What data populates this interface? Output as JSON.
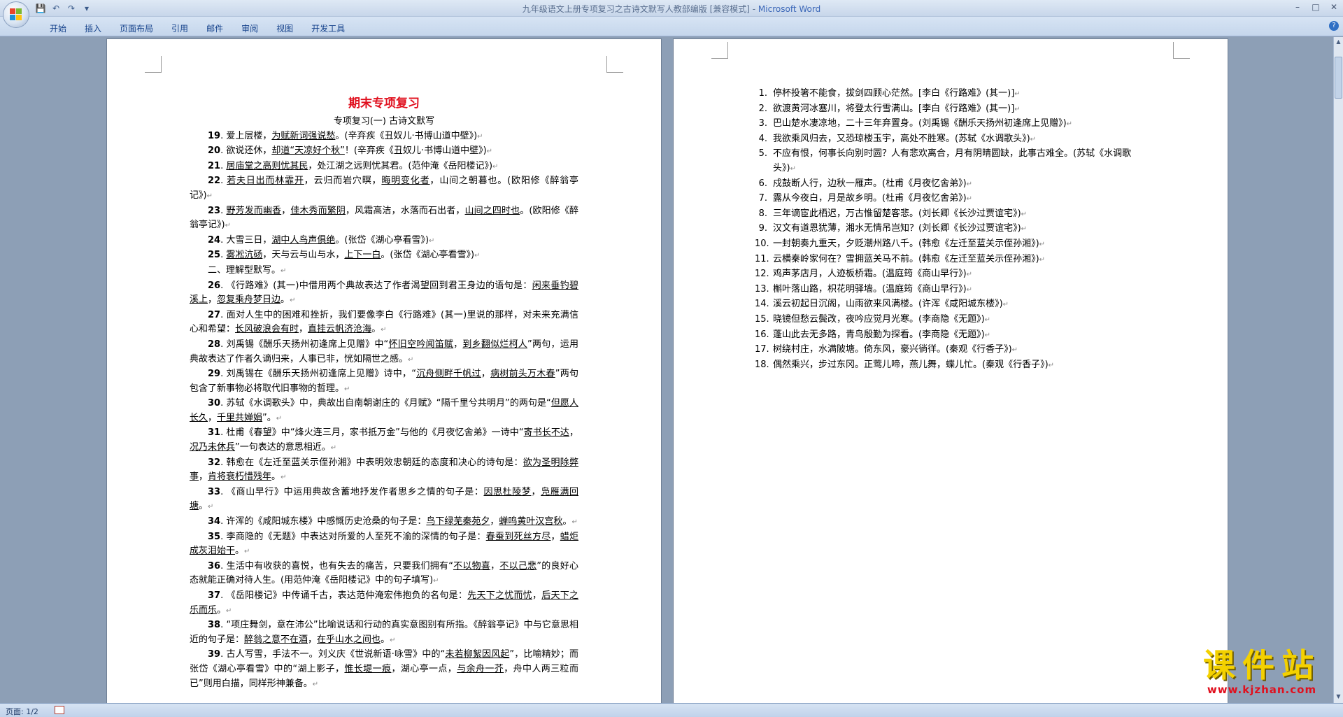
{
  "titlebar": {
    "doc_name": "九年级语文上册专项复习之古诗文默写人教部编版 [兼容模式] - ",
    "app_name": "Microsoft Word",
    "qat_icons": [
      "save-icon",
      "undo-icon",
      "redo-icon",
      "customize-icon"
    ],
    "window_controls": [
      "minimize-icon",
      "maximize-icon",
      "close-icon"
    ]
  },
  "ribbon": {
    "tabs": [
      "开始",
      "插入",
      "页面布局",
      "引用",
      "邮件",
      "审阅",
      "视图",
      "开发工具"
    ]
  },
  "page_left": {
    "title": "期末专项复习",
    "subtitle": "专项复习(一)   古诗文默写",
    "items": [
      {
        "n": "19",
        "segs": [
          {
            "t": "爱上层楼，"
          },
          {
            "t": "为赋新词强说愁",
            "u": true
          },
          {
            "t": "。(辛弃疾《丑奴儿·书博山道中壁》)"
          }
        ]
      },
      {
        "n": "20",
        "segs": [
          {
            "t": "欲说还休，"
          },
          {
            "t": "却道“天凉好个秋”",
            "u": true
          },
          {
            "t": "！(辛弃疾《丑奴儿·书博山道中壁》)"
          }
        ]
      },
      {
        "n": "21",
        "segs": [
          {
            "t": "居庙堂之高则忧其民",
            "u": true
          },
          {
            "t": "，处江湖之远则忧其君。(范仲淹《岳阳楼记》)"
          }
        ]
      },
      {
        "n": "22",
        "segs": [
          {
            "t": "若夫日出而林霏开",
            "u": true
          },
          {
            "t": "，云归而岩穴暝，"
          },
          {
            "t": "晦明变化者",
            "u": true
          },
          {
            "t": "，山间之朝暮也。(欧阳修《醉翁亭记》)"
          }
        ]
      },
      {
        "n": "23",
        "segs": [
          {
            "t": "野芳发而幽香",
            "u": true
          },
          {
            "t": "，"
          },
          {
            "t": "佳木秀而繁阴",
            "u": true
          },
          {
            "t": "，风霜高洁，水落而石出者，"
          },
          {
            "t": "山间之四时也",
            "u": true
          },
          {
            "t": "。(欧阳修《醉翁亭记》)"
          }
        ]
      },
      {
        "n": "24",
        "segs": [
          {
            "t": "大雪三日，"
          },
          {
            "t": "湖中人鸟声俱绝",
            "u": true
          },
          {
            "t": "。(张岱《湖心亭看雪》)"
          }
        ]
      },
      {
        "n": "25",
        "segs": [
          {
            "t": "雾凇沆砀",
            "u": true
          },
          {
            "t": "，天与云与山与水，"
          },
          {
            "t": "上下一白",
            "u": true
          },
          {
            "t": "。(张岱《湖心亭看雪》)"
          }
        ]
      },
      {
        "n": "",
        "segs": [
          {
            "t": "二、理解型默写。"
          }
        ]
      },
      {
        "n": "26",
        "segs": [
          {
            "t": "《行路难》(其一)中借用两个典故表达了作者渴望回到君王身边的语句是："
          },
          {
            "t": "闲来垂钓碧溪上",
            "u": true
          },
          {
            "t": "，"
          },
          {
            "t": "忽复乘舟梦日边",
            "u": true
          },
          {
            "t": "。"
          }
        ]
      },
      {
        "n": "27",
        "segs": [
          {
            "t": "面对人生中的困难和挫折，我们要像李白《行路难》(其一)里说的那样，对未来充满信心和希望："
          },
          {
            "t": "长风破浪会有时",
            "u": true
          },
          {
            "t": "，"
          },
          {
            "t": "直挂云帆济沧海",
            "u": true
          },
          {
            "t": "。"
          }
        ]
      },
      {
        "n": "28",
        "segs": [
          {
            "t": "刘禹锡《酬乐天扬州初逢席上见赠》中“"
          },
          {
            "t": "怀旧空吟闻笛赋",
            "u": true
          },
          {
            "t": "，"
          },
          {
            "t": "到乡翻似烂柯人",
            "u": true
          },
          {
            "t": "”两句，运用典故表达了作者久谪归来，人事已非，恍如隔世之感。"
          }
        ]
      },
      {
        "n": "29",
        "segs": [
          {
            "t": "刘禹锡在《酬乐天扬州初逢席上见赠》诗中，“"
          },
          {
            "t": "沉舟侧畔千帆过",
            "u": true
          },
          {
            "t": "，"
          },
          {
            "t": "病树前头万木春",
            "u": true
          },
          {
            "t": "”两句包含了新事物必将取代旧事物的哲理。"
          }
        ]
      },
      {
        "n": "30",
        "segs": [
          {
            "t": "苏轼《水调歌头》中，典故出自南朝谢庄的《月赋》“隔千里兮共明月”的两句是“"
          },
          {
            "t": "但愿人长久",
            "u": true
          },
          {
            "t": "，"
          },
          {
            "t": "千里共婵娟",
            "u": true
          },
          {
            "t": "”。"
          }
        ]
      },
      {
        "n": "31",
        "segs": [
          {
            "t": "杜甫《春望》中“烽火连三月，家书抵万金”与他的《月夜忆舍弟》一诗中“"
          },
          {
            "t": "寄书长不达",
            "u": true
          },
          {
            "t": "，"
          },
          {
            "t": "况乃未休兵",
            "u": true
          },
          {
            "t": "”一句表达的意思相近。"
          }
        ]
      },
      {
        "n": "32",
        "segs": [
          {
            "t": "韩愈在《左迁至蓝关示侄孙湘》中表明效忠朝廷的态度和决心的诗句是："
          },
          {
            "t": "欲为圣明除弊事",
            "u": true
          },
          {
            "t": "，"
          },
          {
            "t": "肯将衰朽惜残年",
            "u": true
          },
          {
            "t": "。"
          }
        ]
      },
      {
        "n": "33",
        "segs": [
          {
            "t": "《商山早行》中运用典故含蓄地抒发作者思乡之情的句子是："
          },
          {
            "t": "因思杜陵梦",
            "u": true
          },
          {
            "t": "，"
          },
          {
            "t": "凫雁满回塘",
            "u": true
          },
          {
            "t": "。"
          }
        ]
      },
      {
        "n": "34",
        "segs": [
          {
            "t": "许浑的《咸阳城东楼》中感慨历史沧桑的句子是："
          },
          {
            "t": "鸟下绿芜秦苑夕",
            "u": true
          },
          {
            "t": "，"
          },
          {
            "t": "蝉鸣黄叶汉宫秋",
            "u": true
          },
          {
            "t": "。"
          }
        ]
      },
      {
        "n": "35",
        "segs": [
          {
            "t": "李商隐的《无题》中表达对所爱的人至死不渝的深情的句子是："
          },
          {
            "t": "春蚕到死丝方尽",
            "u": true
          },
          {
            "t": "，"
          },
          {
            "t": "蜡炬成灰泪始干",
            "u": true
          },
          {
            "t": "。"
          }
        ]
      },
      {
        "n": "36",
        "segs": [
          {
            "t": "生活中有收获的喜悦，也有失去的痛苦，只要我们拥有“"
          },
          {
            "t": "不以物喜",
            "u": true
          },
          {
            "t": "，"
          },
          {
            "t": "不以己悲",
            "u": true
          },
          {
            "t": "”的良好心态就能正确对待人生。(用范仲淹《岳阳楼记》中的句子填写)"
          }
        ]
      },
      {
        "n": "37",
        "segs": [
          {
            "t": "《岳阳楼记》中传诵千古，表达范仲淹宏伟抱负的名句是："
          },
          {
            "t": "先天下之忧而忧",
            "u": true
          },
          {
            "t": "，"
          },
          {
            "t": "后天下之乐而乐",
            "u": true
          },
          {
            "t": "。"
          }
        ]
      },
      {
        "n": "38",
        "segs": [
          {
            "t": "“项庄舞剑，意在沛公”比喻说话和行动的真实意图别有所指。《醉翁亭记》中与它意思相近的句子是："
          },
          {
            "t": "醉翁之意不在酒",
            "u": true
          },
          {
            "t": "，"
          },
          {
            "t": "在乎山水之间也",
            "u": true
          },
          {
            "t": "。"
          }
        ]
      },
      {
        "n": "39",
        "segs": [
          {
            "t": "古人写雪，手法不一。刘义庆《世说新语·咏雪》中的“"
          },
          {
            "t": "未若柳絮因风起",
            "u": true
          },
          {
            "t": "”，比喻精妙；而张岱《湖心亭看雪》中的“湖上影子，"
          },
          {
            "t": "惟长堤一痕",
            "u": true
          },
          {
            "t": "，湖心亭一点，"
          },
          {
            "t": "与余舟一芥",
            "u": true
          },
          {
            "t": "，舟中人两三粒而已”则用白描，同样形神兼备。"
          }
        ]
      }
    ]
  },
  "page_right": {
    "items": [
      {
        "n": "1",
        "t": "停杯投箸不能食，拔剑四顾心茫然。[李白《行路难》(其一)]"
      },
      {
        "n": "2",
        "t": "欲渡黄河冰塞川，将登太行雪满山。[李白《行路难》(其一)]"
      },
      {
        "n": "3",
        "t": "巴山楚水凄凉地，二十三年弃置身。(刘禹锡《酬乐天扬州初逢席上见赠》)"
      },
      {
        "n": "4",
        "t": "我欲乘风归去，又恐琼楼玉宇，高处不胜寒。(苏轼《水调歌头》)"
      },
      {
        "n": "5",
        "t": "不应有恨，何事长向别时圆？人有悲欢离合，月有阴晴圆缺，此事古难全。(苏轼《水调歌头》)"
      },
      {
        "n": "6",
        "t": "戍鼓断人行，边秋一雁声。(杜甫《月夜忆舍弟》)"
      },
      {
        "n": "7",
        "t": "露从今夜白，月是故乡明。(杜甫《月夜忆舍弟》)"
      },
      {
        "n": "8",
        "t": "三年谪宦此栖迟，万古惟留楚客悲。(刘长卿《长沙过贾谊宅》)"
      },
      {
        "n": "9",
        "t": "汉文有道恩犹薄，湘水无情吊岂知？(刘长卿《长沙过贾谊宅》)"
      },
      {
        "n": "10",
        "t": "一封朝奏九重天，夕贬潮州路八千。(韩愈《左迁至蓝关示侄孙湘》)"
      },
      {
        "n": "11",
        "t": "云横秦岭家何在？雪拥蓝关马不前。(韩愈《左迁至蓝关示侄孙湘》)"
      },
      {
        "n": "12",
        "t": "鸡声茅店月，人迹板桥霜。(温庭筠《商山早行》)"
      },
      {
        "n": "13",
        "t": "槲叶落山路，枳花明驿墙。(温庭筠《商山早行》)"
      },
      {
        "n": "14",
        "t": "溪云初起日沉阁，山雨欲来风满楼。(许浑《咸阳城东楼》)"
      },
      {
        "n": "15",
        "t": "晓镜但愁云鬓改，夜吟应觉月光寒。(李商隐《无题》)"
      },
      {
        "n": "16",
        "t": "蓬山此去无多路，青鸟殷勤为探看。(李商隐《无题》)"
      },
      {
        "n": "17",
        "t": "树绕村庄，水满陂塘。倚东风，豪兴徜徉。(秦观《行香子》)"
      },
      {
        "n": "18",
        "t": "偶然乘兴，步过东冈。正莺儿啼，燕儿舞，蝶儿忙。(秦观《行香子》)"
      }
    ]
  },
  "statusbar": {
    "page_info": "页面: 1/2"
  },
  "watermark": {
    "text": "课件站",
    "url": "www.kjzhan.com"
  }
}
